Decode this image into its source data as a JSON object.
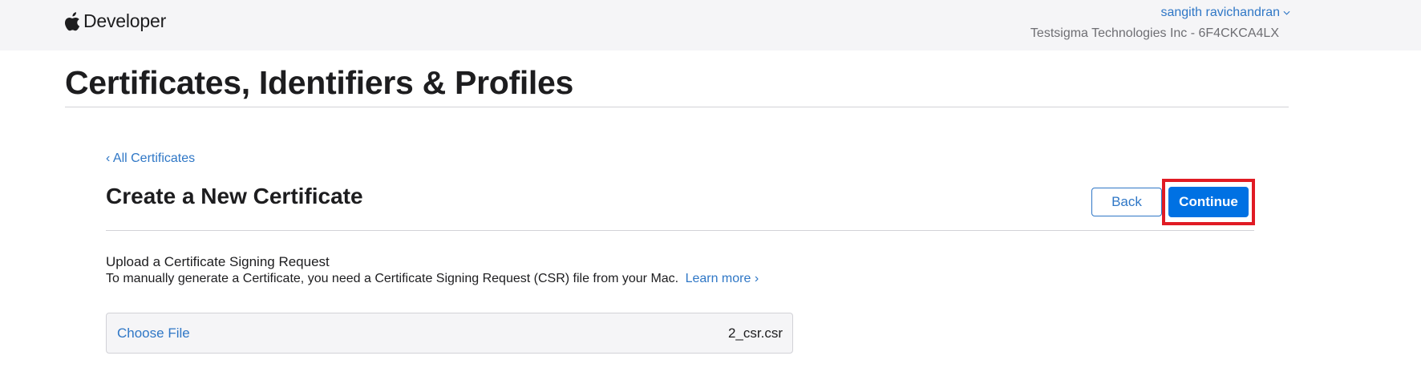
{
  "header": {
    "brand": "Developer",
    "user_name": "sangith ravichandran",
    "team": "Testsigma Technologies Inc - 6F4CKCA4LX"
  },
  "page": {
    "title": "Certificates, Identifiers & Profiles"
  },
  "breadcrumb": {
    "back_link": "‹ All Certificates"
  },
  "section": {
    "title": "Create a New Certificate",
    "back_button": "Back",
    "continue_button": "Continue"
  },
  "upload": {
    "heading": "Upload a Certificate Signing Request",
    "description": "To manually generate a Certificate, you need a Certificate Signing Request (CSR) file from your Mac.",
    "learn_more": "Learn more ›",
    "choose_file": "Choose File",
    "file_name": "2_csr.csr"
  },
  "icons": {
    "brand_logo": "apple-logo-icon",
    "account_menu": "chevron-down-icon"
  },
  "colors": {
    "link": "#2f77c6",
    "primary_button": "#0071e3",
    "highlight": "#e01b24",
    "header_bg": "#f5f5f7"
  }
}
